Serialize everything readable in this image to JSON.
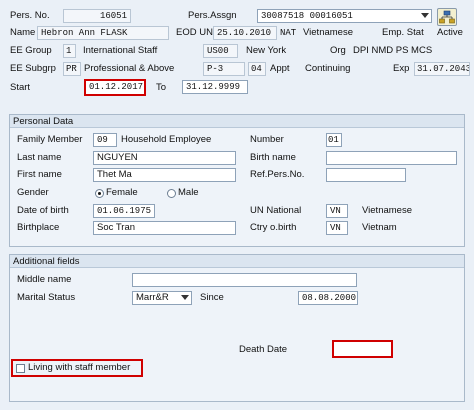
{
  "header": {
    "pers_no_label": "Pers. No.",
    "pers_no_value": "16051",
    "pers_assgn_label": "Pers.Assgn",
    "pers_assgn_value": "30087518 00016051",
    "name_label": "Name",
    "name_value": "Hebron Ann FLASK",
    "eod_un_label": "EOD UN",
    "eod_un_value": "25.10.2010",
    "nat_label": "NAT",
    "nat_value": "Vietnamese",
    "emp_stat_label": "Emp. Stat",
    "emp_stat_value": "Active",
    "ee_group_label": "EE Group",
    "ee_group_code": "1",
    "ee_group_text": "International Staff",
    "loc_code": "US00",
    "loc_text": "New York",
    "org_label": "Org",
    "org_text": "DPI NMD PS MCS",
    "ee_subgrp_label": "EE Subgrp",
    "ee_subgrp_code": "PR",
    "ee_subgrp_text": "Professional & Above",
    "grade_code": "P-3",
    "step_code": "04",
    "appt_label": "Appt",
    "appt_text": "Continuing",
    "exp_label": "Exp",
    "exp_value": "31.07.2043",
    "start_label": "Start",
    "start_value": "01.12.2017",
    "to_label": "To",
    "to_value": "31.12.9999"
  },
  "personal": {
    "title": "Personal Data",
    "family_member_label": "Family Member",
    "family_member_code": "09",
    "family_member_text": "Household Employee",
    "number_label": "Number",
    "number_value": "01",
    "last_name_label": "Last name",
    "last_name_value": "NGUYEN",
    "birth_name_label": "Birth name",
    "birth_name_value": "",
    "first_name_label": "First name",
    "first_name_value": "Thet Ma",
    "ref_pers_no_label": "Ref.Pers.No.",
    "ref_pers_no_value": "",
    "gender_label": "Gender",
    "female_label": "Female",
    "male_label": "Male",
    "selected_gender": "Female",
    "dob_label": "Date of birth",
    "dob_value": "01.06.1975",
    "un_national_label": "UN National",
    "un_national_code": "VN",
    "un_national_text": "Vietnamese",
    "birthplace_label": "Birthplace",
    "birthplace_value": "Soc Tran",
    "ctry_birth_label": "Ctry o.birth",
    "ctry_birth_code": "VN",
    "ctry_birth_text": "Vietnam"
  },
  "additional": {
    "title": "Additional fields",
    "middle_name_label": "Middle name",
    "middle_name_value": "",
    "marital_status_label": "Marital Status",
    "marital_status_value": "Marr&R",
    "since_label": "Since",
    "since_value": "08.08.2000",
    "death_date_label": "Death Date",
    "death_date_value": "",
    "living_with_staff_label": "Living with staff member",
    "living_with_staff_checked": false
  },
  "colors": {
    "highlight": "#d00000",
    "background": "#eaf0f7"
  },
  "icons": {
    "org_structure": "org-structure-icon",
    "dropdown": "chevron-down-icon"
  }
}
